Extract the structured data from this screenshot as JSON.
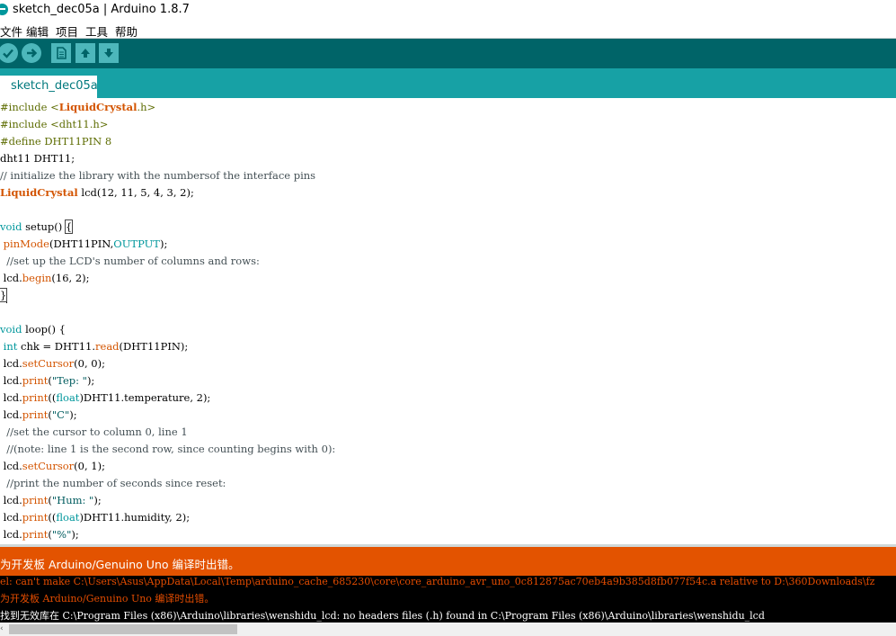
{
  "window": {
    "title": "sketch_dec05a | Arduino 1.8.7"
  },
  "menu": {
    "items": [
      "文件",
      "编辑",
      "项目",
      "工具",
      "帮助"
    ]
  },
  "toolbar": {
    "buttons": [
      "verify-icon",
      "upload-icon",
      "new-icon",
      "open-icon",
      "save-icon"
    ]
  },
  "tabs": [
    {
      "label": "sketch_dec05a"
    }
  ],
  "editor": {
    "lines": {
      "l1": {
        "a": "#include <",
        "b": "LiquidCrystal",
        "c": ".h>"
      },
      "l2": {
        "a": "#include <dht11.h>"
      },
      "l3": {
        "a": "#define DHT11PIN 8"
      },
      "l4": {
        "a": "dht11 DHT11;"
      },
      "l5": {
        "a": "// initialize the library with the numbersof the interface pins"
      },
      "l6": {
        "a": "LiquidCrystal",
        "b": " lcd(12, 11, 5, 4, 3, 2);"
      },
      "l8": {
        "a": "void",
        "b": " setup() ",
        "c": "{"
      },
      "l9": {
        "a": " ",
        "b": "pinMode",
        "c": "(DHT11PIN,",
        "d": "OUTPUT",
        "e": ");"
      },
      "l10": {
        "a": "  //set up the LCD's number of columns and rows:"
      },
      "l11": {
        "a": " lcd.",
        "b": "begin",
        "c": "(16, 2);"
      },
      "l12": {
        "a": "}"
      },
      "l14": {
        "a": "void",
        "b": " loop() {"
      },
      "l15": {
        "a": " ",
        "b": "int",
        "c": " chk = DHT11.",
        "d": "read",
        "e": "(DHT11PIN);"
      },
      "l16": {
        "a": " lcd.",
        "b": "setCursor",
        "c": "(0, 0);"
      },
      "l17": {
        "a": " lcd.",
        "b": "print",
        "c": "(",
        "d": "\"Tep: \"",
        "e": ");"
      },
      "l18": {
        "a": " lcd.",
        "b": "print",
        "c": "((",
        "d": "float",
        "e": ")DHT11.temperature, 2);"
      },
      "l19": {
        "a": " lcd.",
        "b": "print",
        "c": "(",
        "d": "\"C\"",
        "e": ");"
      },
      "l20": {
        "a": "  //set the cursor to column 0, line 1"
      },
      "l21": {
        "a": "  //(note: line 1 is the second row, since counting begins with 0):"
      },
      "l22": {
        "a": " lcd.",
        "b": "setCursor",
        "c": "(0, 1);"
      },
      "l23": {
        "a": "  //print the number of seconds since reset:"
      },
      "l24": {
        "a": " lcd.",
        "b": "print",
        "c": "(",
        "d": "\"Hum: \"",
        "e": ");"
      },
      "l25": {
        "a": " lcd.",
        "b": "print",
        "c": "((",
        "d": "float",
        "e": ")DHT11.humidity, 2);"
      },
      "l26": {
        "a": " lcd.",
        "b": "print",
        "c": "(",
        "d": "\"%\"",
        "e": ");"
      }
    }
  },
  "status": {
    "message": "为开发板 Arduino/Genuino Uno 编译时出错。"
  },
  "console": {
    "lines": [
      "el: can't make C:\\Users\\Asus\\AppData\\Local\\Temp\\arduino_cache_685230\\core\\core_arduino_avr_uno_0c812875ac70eb4a9b385d8fb077f54c.a relative to D:\\360Downloads\\fz",
      "为开发板 Arduino/Genuino Uno 编译时出错。",
      "找到无效库在 C:\\Program Files (x86)\\Arduino\\libraries\\wenshidu_lcd: no headers files (.h) found in C:\\Program Files (x86)\\Arduino\\libraries\\wenshidu_lcd"
    ]
  },
  "colors": {
    "toolbar": "#006468",
    "tabstrip": "#17a1a5",
    "status_error": "#e35300",
    "console_bg": "#000000",
    "error_text": "#e34c00"
  }
}
